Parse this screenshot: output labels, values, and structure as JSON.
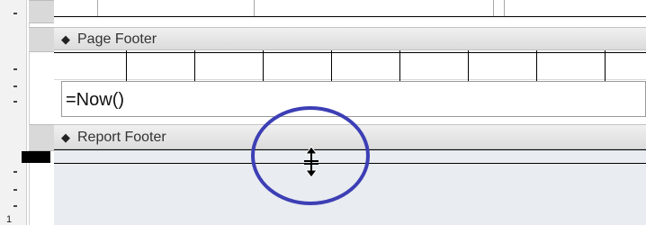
{
  "sections": {
    "page_footer": {
      "label": "Page Footer",
      "icon": "section-arrow-icon"
    },
    "report_footer": {
      "label": "Report Footer",
      "icon": "section-arrow-icon"
    }
  },
  "controls": {
    "now_textbox": "=Now()"
  },
  "ruler": {
    "number": "1"
  },
  "cursor": {
    "icon": "resize-vertical-icon"
  },
  "colors": {
    "section_bar": "#e4e4e4",
    "report_footer_body": "#e9ecf0",
    "highlight_circle": "#3d3fb5"
  }
}
